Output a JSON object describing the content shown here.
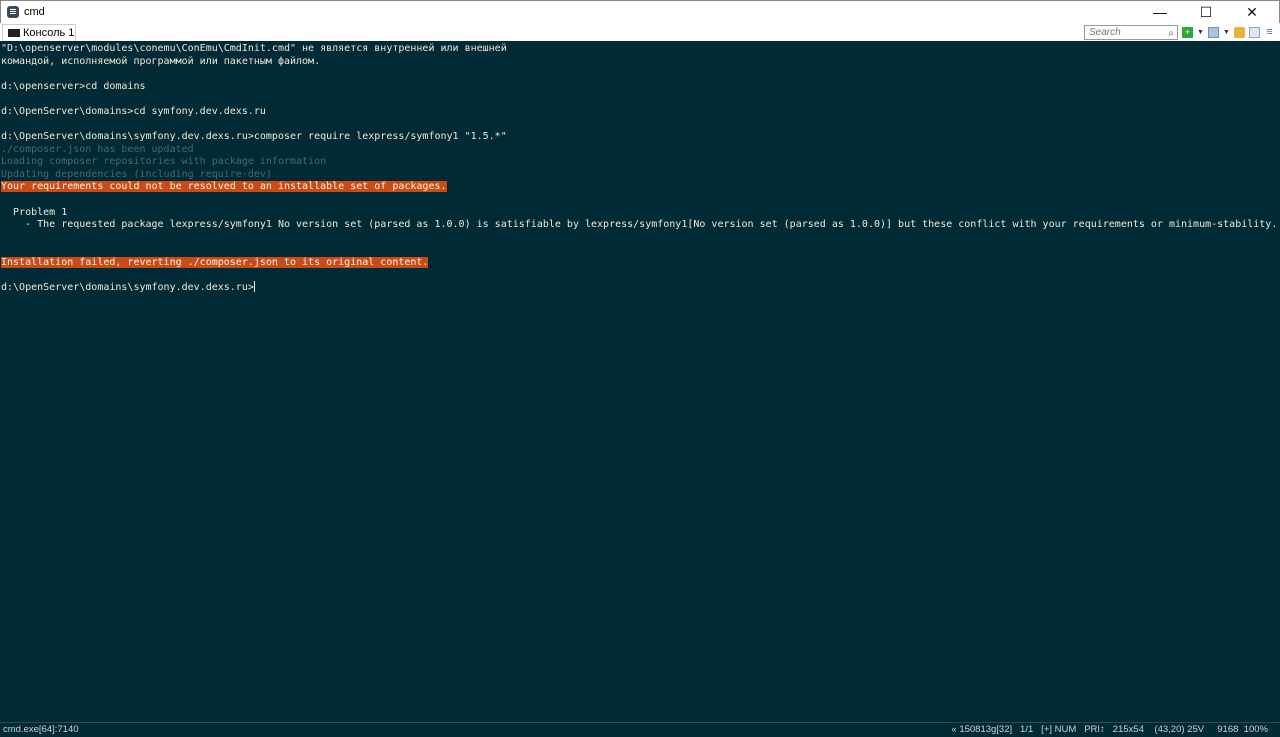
{
  "window": {
    "title": "cmd",
    "minimize": "—",
    "maximize": "☐",
    "close": "✕"
  },
  "tab": {
    "label": "Консоль 1"
  },
  "toolbar": {
    "search_placeholder": "Search",
    "search_icon": "⌕"
  },
  "terminal": {
    "lines": [
      {
        "text": "\"D:\\openserver\\modules\\conemu\\ConEmu\\CmdInit.cmd\" не является внутренней или внешней",
        "style": "normal"
      },
      {
        "text": "командой, исполняемой программой или пакетным файлом.",
        "style": "normal"
      },
      {
        "text": "",
        "style": "normal"
      },
      {
        "text": "d:\\openserver>cd domains",
        "style": "normal"
      },
      {
        "text": "",
        "style": "normal"
      },
      {
        "text": "d:\\OpenServer\\domains>cd symfony.dev.dexs.ru",
        "style": "normal"
      },
      {
        "text": "",
        "style": "normal"
      },
      {
        "text": "d:\\OpenServer\\domains\\symfony.dev.dexs.ru>composer require lexpress/symfony1 \"1.5.*\"",
        "style": "normal"
      },
      {
        "text": "./composer.json has been updated",
        "style": "dim"
      },
      {
        "text": "Loading composer repositories with package information",
        "style": "dim"
      },
      {
        "text": "Updating dependencies (including require-dev)",
        "style": "dim"
      },
      {
        "text": "Your requirements could not be resolved to an installable set of packages.",
        "style": "err"
      },
      {
        "text": "",
        "style": "normal"
      },
      {
        "text": "  Problem 1",
        "style": "normal"
      },
      {
        "text": "    - The requested package lexpress/symfony1 No version set (parsed as 1.0.0) is satisfiable by lexpress/symfony1[No version set (parsed as 1.0.0)] but these conflict with your requirements or minimum-stability.",
        "style": "normal"
      },
      {
        "text": "",
        "style": "normal"
      },
      {
        "text": "",
        "style": "normal"
      },
      {
        "text": "Installation failed, reverting ./composer.json to its original content.",
        "style": "err"
      },
      {
        "text": "",
        "style": "normal"
      },
      {
        "text": "d:\\OpenServer\\domains\\symfony.dev.dexs.ru>",
        "style": "prompt"
      }
    ],
    "colors": {
      "background": "#002b36",
      "foreground": "#eee8d5",
      "dim": "#4a6670",
      "error_bg": "#cb4b16"
    }
  },
  "statusbar": {
    "process": "cmd.exe[64]:7140",
    "right": "« 150813g[32]   1/1   [+] NUM   PRI↕   215x54    (43,20) 25V     9168  100%"
  }
}
